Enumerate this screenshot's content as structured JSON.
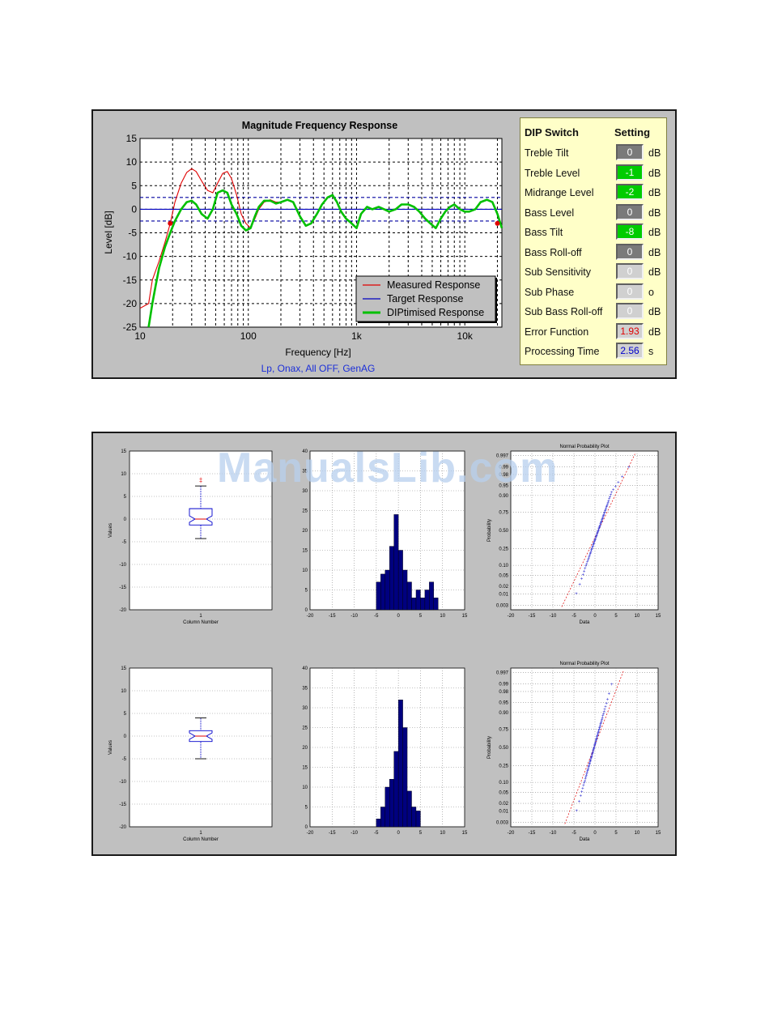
{
  "top_chart": {
    "title": "Magnitude Frequency Response",
    "xlabel": "Frequency [Hz]",
    "ylabel": "Level [dB]",
    "subtitle": "Lp, Onax, All OFF, GenAG",
    "y_ticks": [
      "15",
      "10",
      "5",
      "0",
      "-5",
      "-10",
      "-15",
      "-20",
      "-25"
    ],
    "x_ticks": [
      "10",
      "100",
      "1k",
      "10k"
    ],
    "legend": [
      "Measured Response",
      "Target Response",
      "DIPtimised Response"
    ],
    "colors": {
      "measured": "#e00000",
      "target": "#0000c0",
      "optimised": "#00c000",
      "dashed_blue": "#0000a0"
    }
  },
  "dip_panel": {
    "header_switch": "DIP Switch",
    "header_setting": "Setting",
    "rows": [
      {
        "label": "Treble Tilt",
        "value": "0",
        "unit": "dB",
        "color": "#7a7a7a",
        "text_color": "#ffffff"
      },
      {
        "label": "Treble Level",
        "value": "-1",
        "unit": "dB",
        "color": "#00cc00",
        "text_color": "#ffffff"
      },
      {
        "label": "Midrange Level",
        "value": "-2",
        "unit": "dB",
        "color": "#00cc00",
        "text_color": "#ffffff"
      },
      {
        "label": "Bass Level",
        "value": "0",
        "unit": "dB",
        "color": "#7a7a7a",
        "text_color": "#ffffff"
      },
      {
        "label": "Bass Tilt",
        "value": "-8",
        "unit": "dB",
        "color": "#00cc00",
        "text_color": "#ffffff"
      },
      {
        "label": "Bass Roll-off",
        "value": "0",
        "unit": "dB",
        "color": "#7a7a7a",
        "text_color": "#ffffff"
      },
      {
        "label": "Sub Sensitivity",
        "value": "0",
        "unit": "dB",
        "color": "#d0d0d0",
        "text_color": "#ffffff"
      },
      {
        "label": "Sub Phase",
        "value": "0",
        "unit": "o",
        "color": "#d0d0d0",
        "text_color": "#ffffff"
      },
      {
        "label": "Sub Bass Roll-off",
        "value": "0",
        "unit": "dB",
        "color": "#d0d0d0",
        "text_color": "#ffffff"
      },
      {
        "label": "Error Function",
        "value": "1.93",
        "unit": "dB",
        "color": "#d0d0d0",
        "text_color": "#e00000"
      },
      {
        "label": "Processing Time",
        "value": "2.56",
        "unit": "s",
        "color": "#d0d0d0",
        "text_color": "#0000cc"
      }
    ]
  },
  "watermark": "ManualsLib.com",
  "small_plots": {
    "box_ylabel": "Values",
    "box_xlabel": "Column Number",
    "box_xtick": "1",
    "box_yticks": [
      "15",
      "10",
      "5",
      "0",
      "-5",
      "-10",
      "-15",
      "-20"
    ],
    "hist_xticks": [
      "-20",
      "-15",
      "-10",
      "-5",
      "0",
      "5",
      "10",
      "15"
    ],
    "hist1_yticks": [
      "40",
      "35",
      "30",
      "25",
      "20",
      "15",
      "10",
      "5",
      "0"
    ],
    "hist2_yticks": [
      "40",
      "35",
      "30",
      "25",
      "20",
      "15",
      "10",
      "5",
      "0"
    ],
    "prob_title": "Normal Probability Plot",
    "prob_ylabel": "Probability",
    "prob_xlabel": "Data",
    "prob_yticks": [
      "0.997",
      "0.99",
      "0.98",
      "0.95",
      "0.90",
      "0.75",
      "0.50",
      "0.25",
      "0.10",
      "0.05",
      "0.02",
      "0.01",
      "0.003"
    ],
    "prob_xticks": [
      "-20",
      "-15",
      "-10",
      "-5",
      "0",
      "5",
      "10",
      "15"
    ]
  },
  "chart_data": [
    {
      "type": "line",
      "title": "Magnitude Frequency Response",
      "xlabel": "Frequency [Hz]",
      "ylabel": "Level [dB]",
      "xscale": "log",
      "xlim": [
        10,
        22000
      ],
      "ylim": [
        -25,
        15
      ],
      "grid": true,
      "legend_position": "bottom-right",
      "reference_lines_dB": [
        2.5,
        -2.5
      ],
      "series": [
        {
          "name": "Measured Response",
          "color": "#e00000",
          "x": [
            10,
            12,
            13,
            15,
            17,
            19,
            21,
            24,
            27,
            30,
            33,
            37,
            42,
            47,
            52,
            58,
            64,
            70,
            78,
            86,
            95,
            105,
            115,
            125,
            140,
            160,
            180,
            200,
            230,
            260,
            300,
            340,
            380,
            430,
            480,
            540,
            600,
            660,
            720,
            800,
            900,
            1000,
            1100,
            1250,
            1400,
            1600,
            1800,
            2000,
            2300,
            2600,
            3000,
            3400,
            3800,
            4300,
            4800,
            5400,
            6000,
            6600,
            7300,
            8000,
            9000,
            10000,
            11000,
            12500,
            14000,
            16000,
            18000,
            20000,
            22000
          ],
          "y": [
            -21,
            -20,
            -15,
            -11,
            -7,
            -3,
            1.5,
            5.5,
            7.8,
            8.6,
            8,
            6,
            4,
            3.5,
            5.5,
            7.6,
            8,
            6.5,
            3,
            -1,
            -3,
            -4,
            -2,
            0,
            1.5,
            2,
            1.5,
            1.5,
            2,
            1.5,
            -1.5,
            -3.5,
            -3,
            -1,
            1,
            2.5,
            3,
            1.5,
            -0.5,
            -2,
            -3,
            -4,
            -1,
            0.5,
            0,
            0.5,
            0,
            -0.5,
            0,
            1,
            1,
            0.5,
            -0.5,
            -2,
            -3,
            -4,
            -2,
            -0.5,
            0.5,
            1,
            0,
            -0.5,
            -0.5,
            0,
            1.5,
            2,
            1.5,
            -1,
            -4
          ]
        },
        {
          "name": "Target Response",
          "color": "#0000c0",
          "x": [
            10,
            22000
          ],
          "y": [
            0,
            0
          ]
        },
        {
          "name": "DIPtimised Response",
          "color": "#00c000",
          "x": [
            12,
            13,
            14,
            15,
            17,
            19,
            21,
            24,
            27,
            30,
            33,
            37,
            42,
            47,
            52,
            58,
            64,
            70,
            78,
            86,
            95,
            105,
            115,
            125,
            140,
            160,
            180,
            200,
            230,
            260,
            300,
            340,
            380,
            430,
            480,
            540,
            600,
            660,
            720,
            800,
            900,
            1000,
            1100,
            1250,
            1400,
            1600,
            1800,
            2000,
            2300,
            2600,
            3000,
            3400,
            3800,
            4300,
            4800,
            5400,
            6000,
            6600,
            7300,
            8000,
            9000,
            10000,
            11000,
            12500,
            14000,
            16000,
            18000,
            20000,
            22000
          ],
          "y": [
            -25,
            -20,
            -16,
            -12.5,
            -8,
            -5,
            -2.5,
            0,
            1.5,
            1.8,
            1,
            -1,
            -2,
            0,
            3.5,
            4,
            3.5,
            1,
            -1,
            -3.5,
            -4.5,
            -4,
            -1.5,
            0.5,
            1.8,
            1.8,
            1.2,
            1.5,
            2,
            1.5,
            -1.5,
            -3.5,
            -3,
            -1,
            1,
            2.5,
            3,
            1.5,
            -0.5,
            -2,
            -3,
            -4,
            -1,
            0.5,
            0,
            0.5,
            0,
            -0.5,
            0,
            1,
            1,
            0.5,
            -0.5,
            -2,
            -3,
            -4,
            -2,
            -0.5,
            0.5,
            1,
            0,
            -0.5,
            -0.5,
            0,
            1.5,
            2,
            1.5,
            -1,
            -4
          ]
        }
      ]
    },
    {
      "type": "box",
      "ylim": [
        -20,
        15
      ],
      "categories": [
        "1"
      ],
      "whisker_low": -4.3,
      "q1": -1.3,
      "median": 0,
      "q3": 2.3,
      "whisker_high": 7.3,
      "outliers": [
        8.2,
        8.8
      ]
    },
    {
      "type": "bar",
      "xlim": [
        -20,
        15
      ],
      "ylim": [
        0,
        40
      ],
      "bin_centers": [
        -4.5,
        -3.5,
        -2.5,
        -1.5,
        -0.5,
        0.5,
        1.5,
        2.5,
        3.5,
        4.5,
        5.5,
        6.5,
        7.5,
        8.5,
        9.5
      ],
      "values": [
        7,
        9,
        10,
        16,
        24,
        15,
        10,
        7,
        3,
        5,
        3,
        5,
        7,
        3,
        0
      ]
    },
    {
      "type": "scatter",
      "title": "Normal Probability Plot",
      "xlabel": "Data",
      "ylabel": "Probability",
      "xlim": [
        -20,
        15
      ],
      "data_range": [
        -4.8,
        8.8
      ],
      "shape": "S-curve, tail bends above the normal line for data above 5"
    },
    {
      "type": "box",
      "ylim": [
        -20,
        15
      ],
      "categories": [
        "1"
      ],
      "whisker_low": -5,
      "q1": -1.2,
      "median": 0,
      "q3": 1.2,
      "whisker_high": 4,
      "outliers": []
    },
    {
      "type": "bar",
      "xlim": [
        -20,
        15
      ],
      "ylim": [
        0,
        40
      ],
      "bin_centers": [
        -4.5,
        -3.5,
        -2.5,
        -1.5,
        -0.5,
        0.5,
        1.5,
        2.5,
        3.5,
        4.5
      ],
      "values": [
        2,
        5,
        10,
        12,
        19,
        32,
        25,
        9,
        5,
        4
      ]
    },
    {
      "type": "scatter",
      "title": "Normal Probability Plot",
      "xlabel": "Data",
      "ylabel": "Probability",
      "xlim": [
        -20,
        15
      ],
      "data_range": [
        -5,
        4.2
      ],
      "shape": "approximately linear"
    }
  ]
}
